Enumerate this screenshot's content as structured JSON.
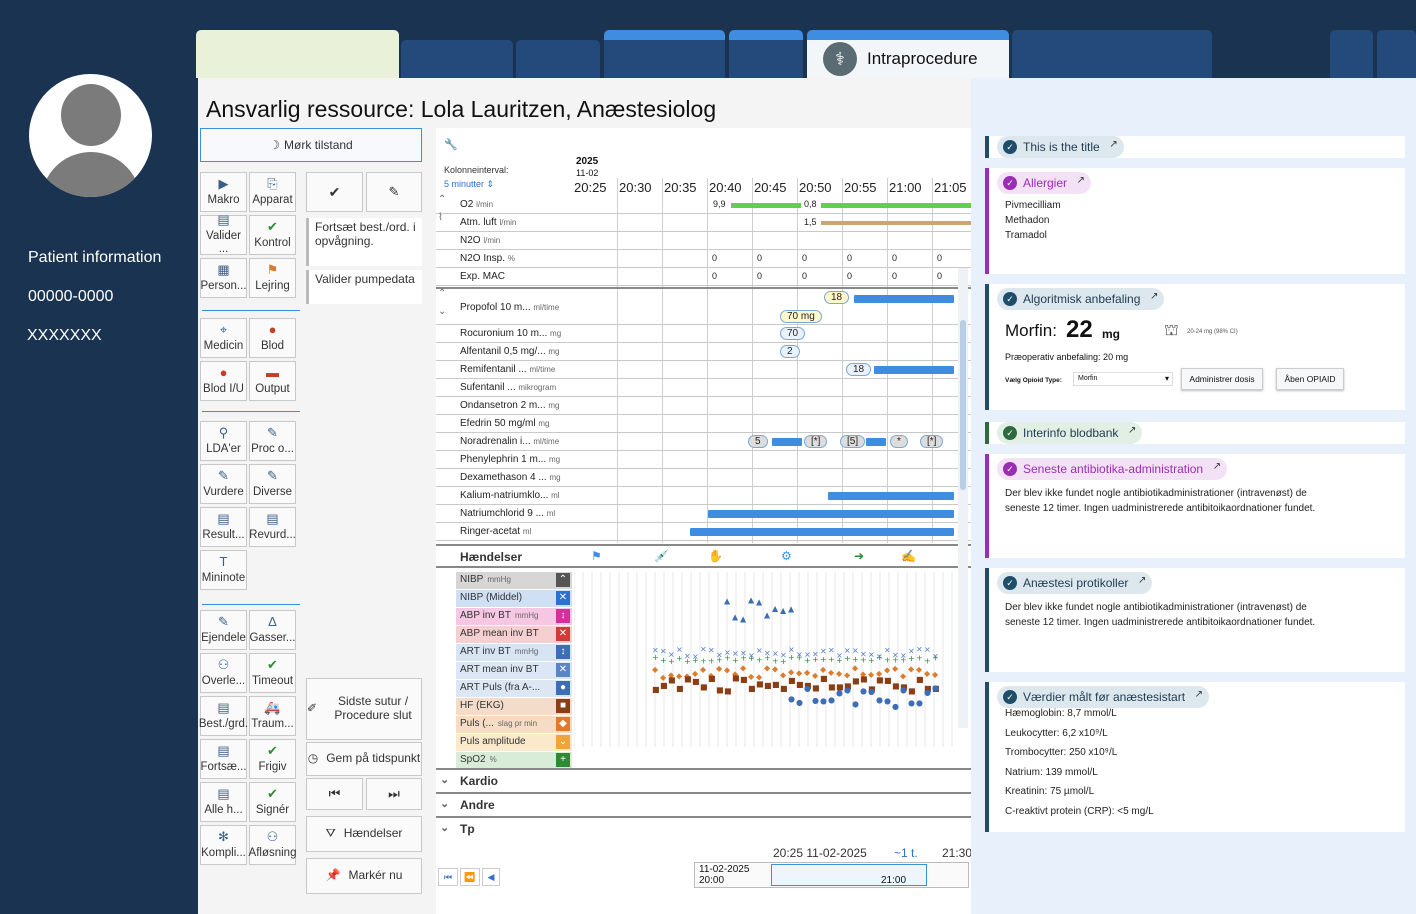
{
  "patient": {
    "label": "Patient information",
    "id": "00000-0000",
    "name": "XXXXXXX"
  },
  "tabs": {
    "active_label": "Intraprocedure"
  },
  "header": {
    "title": "Ansvarlig ressource: Lola Lauritzen, Anæstesiolog",
    "dark_mode_label": "Mørk tilstand"
  },
  "toolbar": {
    "buttons": [
      {
        "label": "Makro",
        "icon": "play-icon"
      },
      {
        "label": "Apparat",
        "icon": "link-icon"
      },
      {
        "label": "Valider ...",
        "icon": "validate-icon"
      },
      {
        "label": "Kontrol",
        "icon": "check-icon"
      },
      {
        "label": "Person...",
        "icon": "person-icon"
      },
      {
        "label": "Lejring",
        "icon": "bed-icon"
      },
      {
        "label": "Medicin",
        "icon": "syringe-icon"
      },
      {
        "label": "Blod",
        "icon": "drop-icon"
      },
      {
        "label": "Blod I/U",
        "icon": "drop-icon"
      },
      {
        "label": "Output",
        "icon": "minus-icon"
      },
      {
        "label": "LDA'er",
        "icon": "lda-icon"
      },
      {
        "label": "Proc o...",
        "icon": "procedure-icon"
      },
      {
        "label": "Vurdere",
        "icon": "pencil-icon"
      },
      {
        "label": "Diverse",
        "icon": "pencil-icon"
      },
      {
        "label": "Result...",
        "icon": "result-icon"
      },
      {
        "label": "Revurd...",
        "icon": "reassess-icon"
      },
      {
        "label": "Mininote",
        "icon": "note-icon"
      },
      {
        "label": "Ejendele",
        "icon": "pencil-icon"
      },
      {
        "label": "Gasser...",
        "icon": "gas-icon"
      },
      {
        "label": "Overle...",
        "icon": "handover-icon"
      },
      {
        "label": "Timeout",
        "icon": "check-icon"
      },
      {
        "label": "Best./grd.",
        "icon": "order-icon"
      },
      {
        "label": "Traum...",
        "icon": "ambulance-icon"
      },
      {
        "label": "Fortsæ...",
        "icon": "order-icon"
      },
      {
        "label": "Frigiv",
        "icon": "release-icon"
      },
      {
        "label": "Alle h...",
        "icon": "list-icon"
      },
      {
        "label": "Signér",
        "icon": "check-icon"
      },
      {
        "label": "Kompli...",
        "icon": "complication-icon"
      },
      {
        "label": "Afløsning",
        "icon": "handover-icon"
      }
    ],
    "continue_text": "Fortsæt best./ord. i opvågning.",
    "validate_pump": "Valider pumpedata",
    "last_suture": "Sidste sutur / Procedure slut",
    "save_time": "Gem på tidspunkt",
    "events_btn": "Hændelser",
    "mark_now": "Markér nu"
  },
  "flowsheet": {
    "interval_label": "Kolonneinterval:",
    "interval_value": "5 minutter",
    "year": "2025",
    "date": "11-02",
    "times": [
      "20:25",
      "20:30",
      "20:35",
      "20:40",
      "20:45",
      "20:50",
      "20:55",
      "21:00",
      "21:05"
    ],
    "gases": [
      {
        "name": "O2",
        "unit": "l/min"
      },
      {
        "name": "Atm. luft",
        "unit": "l/min"
      },
      {
        "name": "N2O",
        "unit": "l/min"
      },
      {
        "name": "N2O Insp.",
        "unit": "%"
      },
      {
        "name": "Exp. MAC",
        "unit": ""
      }
    ],
    "o2_values": [
      "9,9",
      "0,8"
    ],
    "air_value": "1,5",
    "zero": "0",
    "meds": [
      {
        "name": "Propofol 10 m...",
        "unit": "ml/time"
      },
      {
        "name": "Rocuronium 10 m...",
        "unit": "mg"
      },
      {
        "name": "Alfentanil 0,5 mg/...",
        "unit": "mg"
      },
      {
        "name": "Remifentanil ...",
        "unit": "ml/time"
      },
      {
        "name": "Sufentanil ...",
        "unit": "mikrogram"
      },
      {
        "name": "Ondansetron 2 m...",
        "unit": "mg"
      },
      {
        "name": "Efedrin 50 mg/ml",
        "unit": "mg"
      },
      {
        "name": "Noradrenalin i...",
        "unit": "ml/time"
      },
      {
        "name": "Phenylephrin 1 m...",
        "unit": "mg"
      },
      {
        "name": "Dexamethason 4 ...",
        "unit": "mg"
      },
      {
        "name": "Kalium-natriumklo...",
        "unit": "ml"
      },
      {
        "name": "Natriumchlorid 9 ...",
        "unit": "ml"
      },
      {
        "name": "Ringer-acetat",
        "unit": "ml"
      }
    ],
    "med_values": {
      "propofol": "18",
      "roc": "70 mg",
      "roc2": "70",
      "alf": "2",
      "remi": "18",
      "nor1": "5",
      "nor2": "[*]",
      "nor3": "[5]",
      "nor4": "*",
      "nor5": "[*]"
    },
    "events_label": "Hændelser",
    "vitals": [
      {
        "name": "NIBP",
        "unit": "mmHg",
        "color": "#d6d6d6",
        "box": "#555555",
        "glyph": "⌃"
      },
      {
        "name": "NIBP (Middel)",
        "unit": "",
        "color": "#cfe0f5",
        "box": "#2f6fd1",
        "glyph": "✕"
      },
      {
        "name": "ABP inv BT",
        "unit": "mmHg",
        "color": "#f6c7e3",
        "box": "#d42f9a",
        "glyph": "↕"
      },
      {
        "name": "ABP mean inv BT",
        "unit": "",
        "color": "#f6d0d0",
        "box": "#d33a3a",
        "glyph": "✕"
      },
      {
        "name": "ART inv BT",
        "unit": "mmHg",
        "color": "#d6e4f4",
        "box": "#3d6eb5",
        "glyph": "↕"
      },
      {
        "name": "ART mean inv BT",
        "unit": "",
        "color": "#dbe7f5",
        "box": "#5b86c6",
        "glyph": "✕"
      },
      {
        "name": "ART Puls (fra A-...",
        "unit": "",
        "color": "#dde7f4",
        "box": "#3d6eb5",
        "glyph": "●"
      },
      {
        "name": "HF (EKG)",
        "unit": "",
        "color": "#f3dcc9",
        "box": "#8a3e14",
        "glyph": "■"
      },
      {
        "name": "Puls (...",
        "unit": "slag pr min",
        "color": "#f6dcc5",
        "box": "#e07b2a",
        "glyph": "◆"
      },
      {
        "name": "Puls amplitude",
        "unit": "",
        "color": "#fbe9cc",
        "box": "#f0a53a",
        "glyph": "⌄"
      },
      {
        "name": "SpO2",
        "unit": "%",
        "color": "#d8ecd7",
        "box": "#2f8a34",
        "glyph": "+"
      }
    ],
    "sections": [
      "Kardio",
      "Andre",
      "Tp"
    ],
    "footer_time": "20:25 11-02-2025",
    "footer_span": "~1 t.",
    "footer_right": "21:30",
    "timeline_left_date": "11-02-2025",
    "timeline_left_time": "20:00",
    "timeline_right": "21:00"
  },
  "cards": [
    {
      "title": "This is the title",
      "color": "#1f4e6b",
      "bg": "#dde7ee"
    },
    {
      "title": "Allergier",
      "color": "#9b2cb4",
      "bg": "#f3e2f6",
      "items": [
        "Pivmecilliam",
        "Methadon",
        "Tramadol"
      ]
    },
    {
      "title": "Algoritmisk anbefaling",
      "color": "#1f4e6b",
      "bg": "#dde7ee",
      "drug": "Morfin:",
      "dose": "22",
      "dose_unit": "mg",
      "ci": "20-24 mg (98% CI)",
      "preop": "Præoperativ anbefaling: 20 mg",
      "opioid_label": "Vælg Opioid Type:",
      "opioid_value": "Morfin",
      "admin_btn": "Administrer dosis",
      "open_btn": "Åben OPIAID"
    },
    {
      "title": "Interinfo blodbank",
      "color": "#2c6b3b",
      "bg": "#e2efe4"
    },
    {
      "title": "Seneste antibiotika-administration",
      "color": "#9b2cb4",
      "bg": "#f3e2f6",
      "text": "Der blev ikke fundet nogle antibiotikadministrationer (intravenøst) de seneste 12 timer. Ingen uadministrerede antibitoikaordnationer fundet."
    },
    {
      "title": "Anæstesi protikoller",
      "color": "#1f4e6b",
      "bg": "#dde7ee",
      "text": "Der blev ikke fundet nogle antibiotikadministrationer (intravenøst) de seneste 12 timer. Ingen uadministrerede antibitoikaordnationer fundet."
    },
    {
      "title": "Værdier målt før anæstesistart",
      "color": "#1f4e6b",
      "bg": "#dde7ee",
      "items": [
        "Hæmoglobin: 8,7 mmol/L",
        "Leukocytter: 6,2 x10⁹/L",
        "Trombocytter: 250 x10⁹/L",
        "Natrium: 139 mmol/L",
        "Kreatinin: 75 µmol/L",
        "C-reaktivt protein (CRP): <5 mg/L"
      ]
    }
  ]
}
